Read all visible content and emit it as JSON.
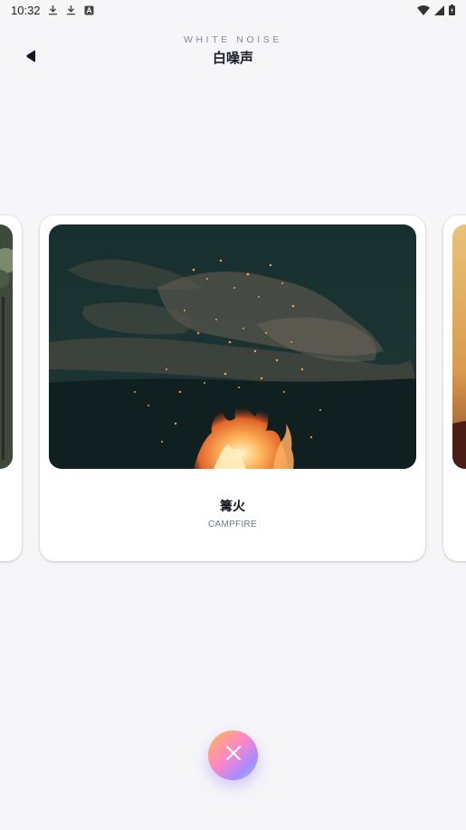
{
  "status_bar": {
    "time": "10:32",
    "icons": [
      "download-icon",
      "download-icon",
      "a-badge-icon",
      "wifi-icon",
      "signal-icon",
      "battery-icon"
    ]
  },
  "header": {
    "subtitle": "WHITE NOISE",
    "title": "白噪声",
    "back_icon": "back-arrow-icon"
  },
  "carousel": {
    "current": {
      "title": "篝火",
      "subtitle": "CAMPFIRE",
      "image": "campfire-photo"
    },
    "previous": {
      "image": "forest-photo"
    },
    "next": {
      "image": "sunset-photo"
    }
  },
  "actions": {
    "close_icon": "close-icon",
    "accent_gradient": [
      "#ffb84d",
      "#ff86c8",
      "#a98bff",
      "#7cc8ff"
    ]
  },
  "colors": {
    "background": "#f6f6f8",
    "subtitle": "#7c8aa5",
    "title": "#1b1b2a"
  }
}
